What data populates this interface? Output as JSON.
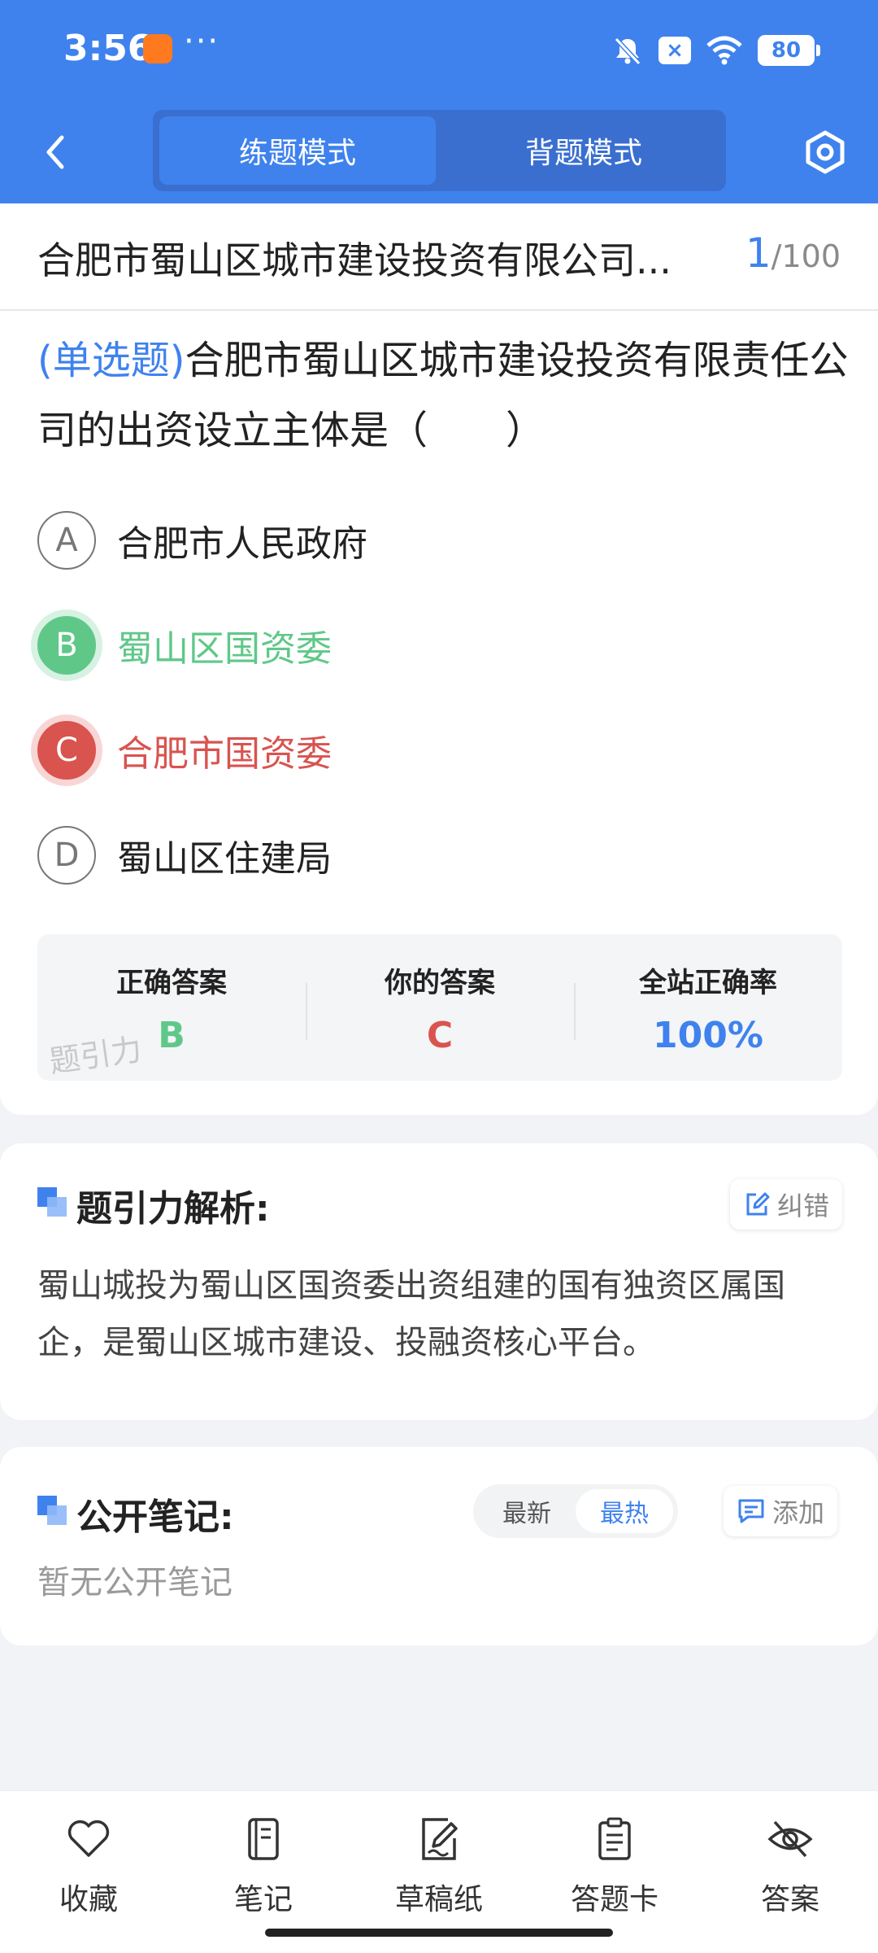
{
  "status_bar": {
    "time": "3:56",
    "dots": "···",
    "battery": "80",
    "x_badge": "×"
  },
  "nav": {
    "back_icon": "chevron-left-icon",
    "modes": [
      "练题模式",
      "背题模式"
    ],
    "active_mode": "练题模式",
    "settings_icon": "hexagon-gear-icon"
  },
  "question": {
    "title": "合肥市蜀山区城市建设投资有限公司...",
    "current": "1",
    "total": "/100",
    "type": "(单选题)",
    "text": "合肥市蜀山区城市建设投资有限责任公司的出资设立主体是（　　）",
    "options": [
      {
        "letter": "A",
        "label": "合肥市人民政府",
        "state": "normal"
      },
      {
        "letter": "B",
        "label": "蜀山区国资委",
        "state": "correct"
      },
      {
        "letter": "C",
        "label": "合肥市国资委",
        "state": "wrong"
      },
      {
        "letter": "D",
        "label": "蜀山区住建局",
        "state": "normal"
      }
    ]
  },
  "stats": {
    "correct_label": "正确答案",
    "correct_value": "B",
    "yours_label": "你的答案",
    "yours_value": "C",
    "rate_label": "全站正确率",
    "rate_value": "100%",
    "watermark": "题引力"
  },
  "analysis": {
    "title": "题引力解析:",
    "report_button": "纠错",
    "text": "蜀山城投为蜀山区国资委出资组建的国有独资区属国企，是蜀山区城市建设、投融资核心平台。"
  },
  "notes": {
    "title": "公开笔记:",
    "sort_latest": "最新",
    "sort_hot": "最热",
    "add_button": "添加",
    "empty_text": "暂无公开笔记"
  },
  "bottom_bar": [
    {
      "label": "收藏",
      "icon": "heart-icon"
    },
    {
      "label": "笔记",
      "icon": "notebook-icon"
    },
    {
      "label": "草稿纸",
      "icon": "draft-paper-icon"
    },
    {
      "label": "答题卡",
      "icon": "answer-card-icon"
    },
    {
      "label": "答案",
      "icon": "eye-off-icon"
    }
  ],
  "colors": {
    "primary": "#3f82ee",
    "correct": "#5fc889",
    "wrong": "#d9534f"
  }
}
